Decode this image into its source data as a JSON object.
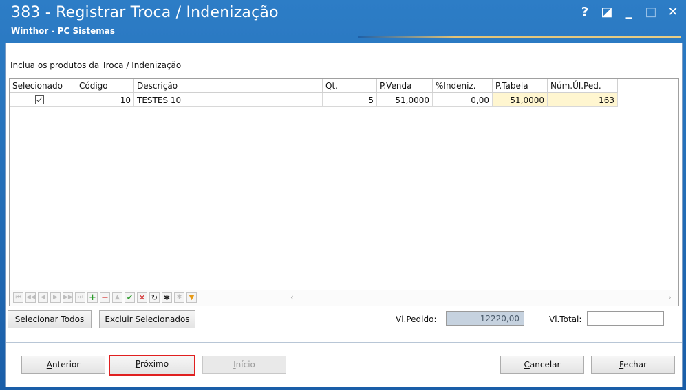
{
  "window": {
    "title": "383 - Registrar Troca / Indenização",
    "subtitle": "Winthor - PC Sistemas",
    "controls": {
      "help": "?",
      "restore": "◪",
      "minimize": "_",
      "maximize": "□",
      "close": "✕"
    }
  },
  "instruction": "Inclua os produtos da Troca / Indenização",
  "grid": {
    "columns": [
      "Selecionado",
      "Código",
      "Descrição",
      "Qt.",
      "P.Venda",
      "%Indeniz.",
      "P.Tabela",
      "Núm.Úl.Ped."
    ],
    "rows": [
      {
        "selecionado": true,
        "codigo": "10",
        "descricao": "TESTES 10",
        "qt": "5",
        "p_venda": "51,0000",
        "indeniz": "0,00",
        "p_tabela": "51,0000",
        "num_ul_ped": "163"
      }
    ]
  },
  "navigator": {
    "first": "⏮",
    "prior_page": "◀◀",
    "prior": "◀",
    "next": "▶",
    "next_page": "▶▶",
    "last": "⏭",
    "insert": "+",
    "delete": "−",
    "edit": "▲",
    "post": "✔",
    "cancel": "✕",
    "refresh": "↻",
    "apply_filter": "✱",
    "clear_filter": "✱",
    "filter": "▼",
    "scroll_left": "‹",
    "scroll_right": "›"
  },
  "buttons": {
    "selecionar_todos": {
      "accel": "S",
      "rest": "elecionar Todos"
    },
    "excluir_selecionados": {
      "accel": "E",
      "rest": "xcluir Selecionados"
    },
    "anterior": {
      "accel": "A",
      "rest": "nterior"
    },
    "proximo": {
      "accel": "P",
      "rest": "róximo"
    },
    "inicio": {
      "accel": "I",
      "rest": "nício"
    },
    "cancelar": {
      "accel": "C",
      "rest": "ancelar"
    },
    "fechar": {
      "accel": "F",
      "rest": "echar"
    }
  },
  "totals": {
    "vl_pedido_label": "Vl.Pedido:",
    "vl_pedido_value": "12220,00",
    "vl_total_label": "Vl.Total:",
    "vl_total_value": ""
  },
  "colors": {
    "title_bar": "#1c5fa8",
    "highlight_border": "#e02020",
    "yellow_cell": "#fff6d0"
  }
}
